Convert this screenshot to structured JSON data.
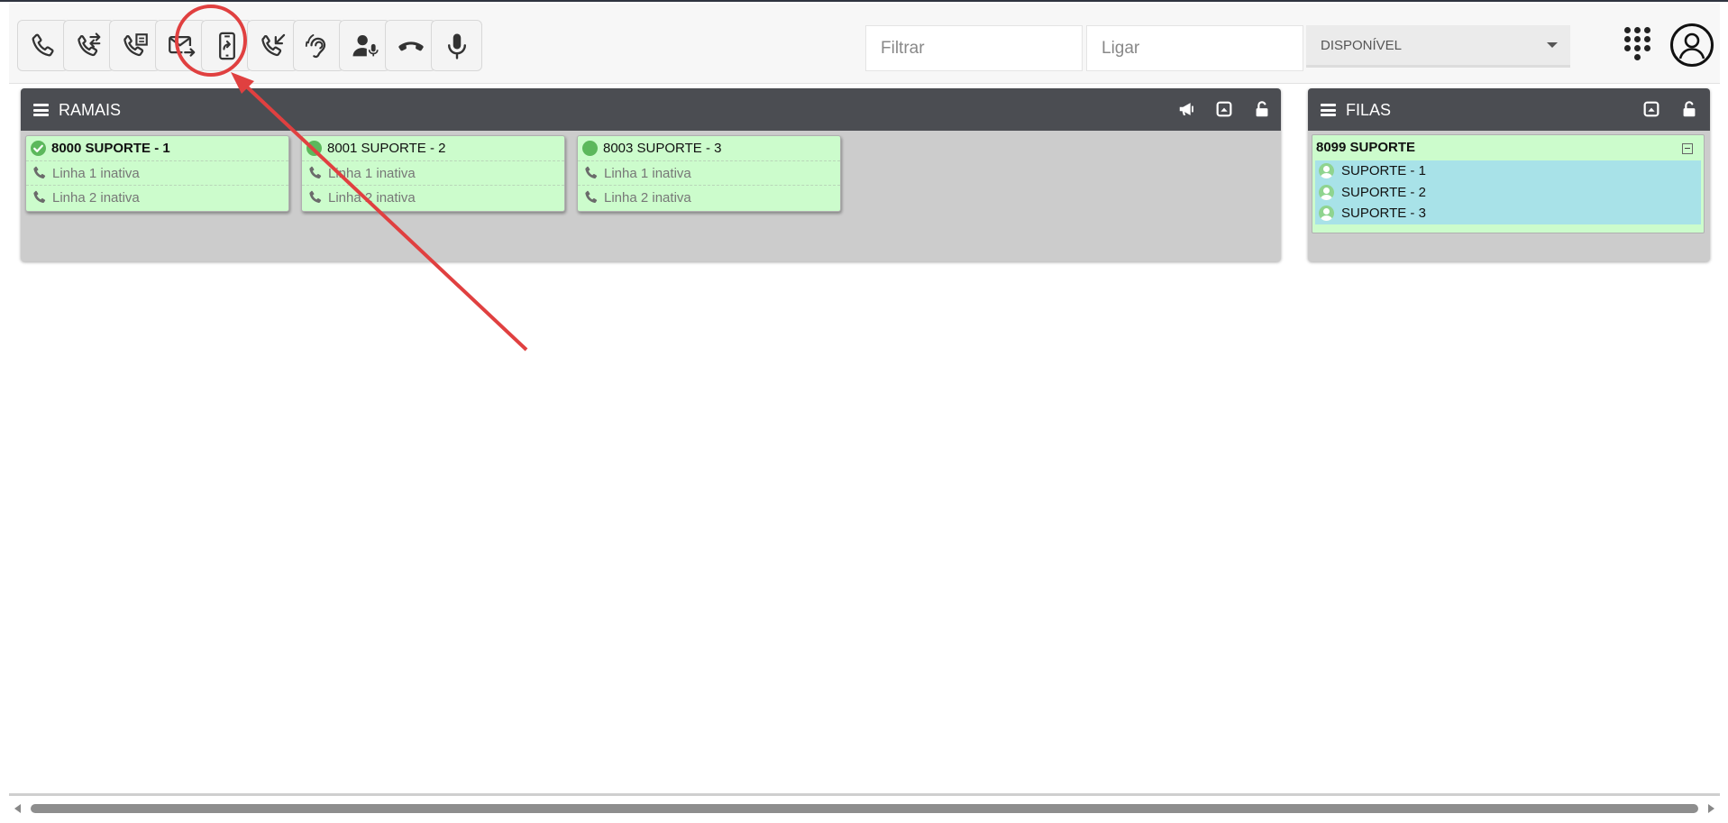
{
  "toolbar": {
    "buttons": [
      {
        "name": "call"
      },
      {
        "name": "transfer-call"
      },
      {
        "name": "consult-transfer"
      },
      {
        "name": "voicemail-forward"
      },
      {
        "name": "mobile-forward"
      },
      {
        "name": "pickup-call"
      },
      {
        "name": "listen-spy"
      },
      {
        "name": "whisper"
      },
      {
        "name": "hangup"
      },
      {
        "name": "mute"
      }
    ],
    "filter_placeholder": "Filtrar",
    "dial_placeholder": "Ligar",
    "status_value": "DISPONÍVEL"
  },
  "ramais": {
    "title": "RAMAIS",
    "extensions": [
      {
        "name": "8000 SUPORTE - 1",
        "line1": "Linha 1 inativa",
        "line2": "Linha 2 inativa",
        "status": "available-active"
      },
      {
        "name": "8001 SUPORTE - 2",
        "line1": "Linha 1 inativa",
        "line2": "Linha 2 inativa",
        "status": "available"
      },
      {
        "name": "8003 SUPORTE - 3",
        "line1": "Linha 1 inativa",
        "line2": "Linha 2 inativa",
        "status": "available"
      }
    ]
  },
  "filas": {
    "title": "FILAS",
    "queue": {
      "name": "8099 SUPORTE",
      "members": [
        "SUPORTE - 1",
        "SUPORTE - 2",
        "SUPORTE - 3"
      ]
    }
  },
  "colors": {
    "panel_header": "#4b4d52",
    "card_bg": "#ccfccc",
    "status_green": "#5cb85c",
    "queue_members_bg": "#a8e2e8",
    "annotation_red": "#e04040"
  }
}
